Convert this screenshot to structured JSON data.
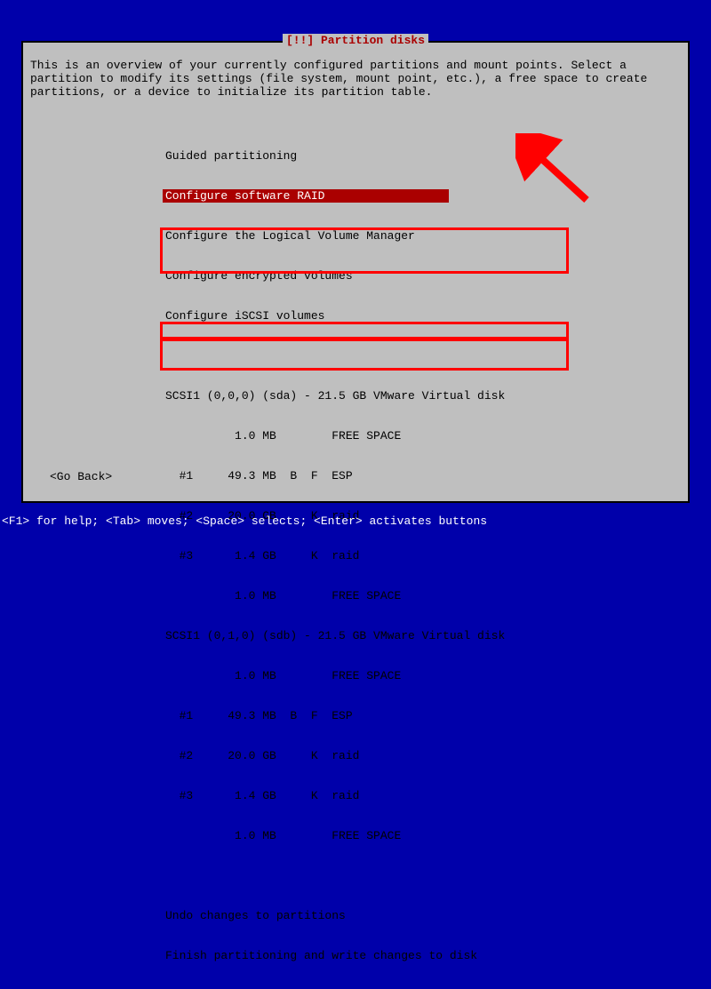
{
  "title": "[!!] Partition disks",
  "description": "This is an overview of your currently configured partitions and mount points. Select a partition to modify its settings (file system, mount point, etc.), a free space to create partitions, or a device to initialize its partition table.",
  "menu": {
    "guided": "Guided partitioning",
    "raid": "Configure software RAID",
    "lvm": "Configure the Logical Volume Manager",
    "encrypted": "Configure encrypted volumes",
    "iscsi": "Configure iSCSI volumes"
  },
  "disk_a": {
    "header": "SCSI1 (0,0,0) (sda) - 21.5 GB VMware Virtual disk",
    "free_top": "          1.0 MB        FREE SPACE",
    "p1": "  #1     49.3 MB  B  F  ESP",
    "p2": "  #2     20.0 GB     K  raid",
    "p3": "  #3      1.4 GB     K  raid",
    "free_bottom": "          1.0 MB        FREE SPACE"
  },
  "disk_b": {
    "header": "SCSI1 (0,1,0) (sdb) - 21.5 GB VMware Virtual disk",
    "free_top": "          1.0 MB        FREE SPACE",
    "p1": "  #1     49.3 MB  B  F  ESP",
    "p2": "  #2     20.0 GB     K  raid",
    "p3": "  #3      1.4 GB     K  raid",
    "free_bottom": "          1.0 MB        FREE SPACE"
  },
  "footer_menu": {
    "undo": "Undo changes to partitions",
    "finish": "Finish partitioning and write changes to disk"
  },
  "go_back": "<Go Back>",
  "help_bar": "<F1> for help; <Tab> moves; <Space> selects; <Enter> activates buttons"
}
